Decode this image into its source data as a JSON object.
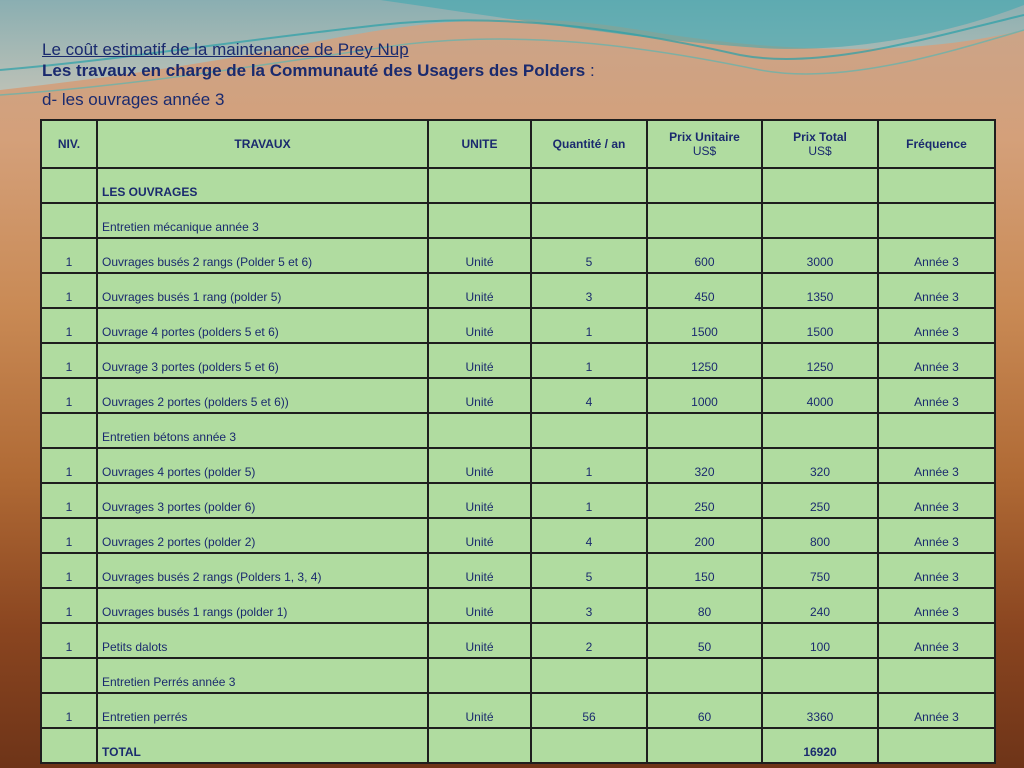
{
  "title": {
    "line1": "Le coût estimatif de la maintenance de Prey Nup",
    "line2_bold": "Les travaux en charge de la Communauté des Usagers des Polders",
    "line2_suffix": " :",
    "line3": "d- les ouvrages année 3"
  },
  "table": {
    "headers": {
      "niv": "NIV.",
      "travaux": "TRAVAUX",
      "unite": "UNITE",
      "quantite": "Quantité / an",
      "prix_unitaire": "Prix Unitaire",
      "prix_unitaire_unit": "US$",
      "prix_total": "Prix Total",
      "prix_total_unit": "US$",
      "frequence": "Fréquence"
    },
    "rows": [
      {
        "niv": "",
        "travaux": "LES OUVRAGES",
        "unite": "",
        "quantite": "",
        "pu": "",
        "pt": "",
        "freq": "",
        "bold": true
      },
      {
        "niv": "",
        "travaux": "Entretien mécanique année 3",
        "unite": "",
        "quantite": "",
        "pu": "",
        "pt": "",
        "freq": ""
      },
      {
        "niv": "1",
        "travaux": "Ouvrages busés 2 rangs (Polder 5 et 6)",
        "unite": "Unité",
        "quantite": "5",
        "pu": "600",
        "pt": "3000",
        "freq": "Année 3"
      },
      {
        "niv": "1",
        "travaux": "Ouvrages busés 1 rang (polder 5)",
        "unite": "Unité",
        "quantite": "3",
        "pu": "450",
        "pt": "1350",
        "freq": "Année 3"
      },
      {
        "niv": "1",
        "travaux": "Ouvrage 4 portes (polders 5 et 6)",
        "unite": "Unité",
        "quantite": "1",
        "pu": "1500",
        "pt": "1500",
        "freq": "Année 3"
      },
      {
        "niv": "1",
        "travaux": "Ouvrage 3 portes (polders 5 et 6)",
        "unite": "Unité",
        "quantite": "1",
        "pu": "1250",
        "pt": "1250",
        "freq": "Année 3"
      },
      {
        "niv": "1",
        "travaux": "Ouvrages 2 portes (polders 5 et 6))",
        "unite": "Unité",
        "quantite": "4",
        "pu": "1000",
        "pt": "4000",
        "freq": "Année 3"
      },
      {
        "niv": "",
        "travaux": "Entretien bétons année 3",
        "unite": "",
        "quantite": "",
        "pu": "",
        "pt": "",
        "freq": ""
      },
      {
        "niv": "1",
        "travaux": "Ouvrages 4 portes (polder 5)",
        "unite": "Unité",
        "quantite": "1",
        "pu": "320",
        "pt": "320",
        "freq": "Année 3"
      },
      {
        "niv": "1",
        "travaux": "Ouvrages 3 portes (polder 6)",
        "unite": "Unité",
        "quantite": "1",
        "pu": "250",
        "pt": "250",
        "freq": "Année 3"
      },
      {
        "niv": "1",
        "travaux": "Ouvrages 2 portes (polder 2)",
        "unite": "Unité",
        "quantite": "4",
        "pu": "200",
        "pt": "800",
        "freq": "Année 3"
      },
      {
        "niv": "1",
        "travaux": "Ouvrages busés 2 rangs (Polders 1, 3, 4)",
        "unite": "Unité",
        "quantite": "5",
        "pu": "150",
        "pt": "750",
        "freq": "Année 3"
      },
      {
        "niv": "1",
        "travaux": "Ouvrages busés 1 rangs (polder 1)",
        "unite": "Unité",
        "quantite": "3",
        "pu": "80",
        "pt": "240",
        "freq": "Année 3"
      },
      {
        "niv": "1",
        "travaux": "Petits dalots",
        "unite": "Unité",
        "quantite": "2",
        "pu": "50",
        "pt": "100",
        "freq": "Année 3"
      },
      {
        "niv": "",
        "travaux": "Entretien Perrés année 3",
        "unite": "",
        "quantite": "",
        "pu": "",
        "pt": "",
        "freq": ""
      },
      {
        "niv": "1",
        "travaux": "Entretien perrés",
        "unite": "Unité",
        "quantite": "56",
        "pu": "60",
        "pt": "3360",
        "freq": "Année 3"
      },
      {
        "niv": "",
        "travaux": "TOTAL",
        "unite": "",
        "quantite": "",
        "pu": "",
        "pt": "16920",
        "freq": "",
        "bold": true
      }
    ]
  },
  "colors": {
    "title_text": "#1a2a6e",
    "table_bg": "#b0dca0",
    "border": "#1e1e1e"
  }
}
